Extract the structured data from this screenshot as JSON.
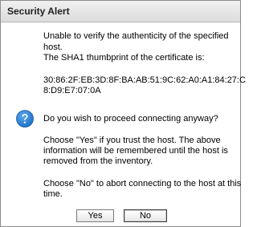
{
  "dialog": {
    "title": "Security Alert",
    "icon": "question-icon",
    "accent_color": "#1a6fc4"
  },
  "message": {
    "line1": "Unable to verify the authenticity of the specified",
    "line2": "host.",
    "line3": "The SHA1 thumbprint of the certificate is:",
    "thumb1": "30:86:2F:EB:3D:8F:BA:AB:51:9C:62:A0:A1:84:27:C",
    "thumb2": "8:D9:E7:07:0A",
    "question": "Do you wish to proceed connecting anyway?",
    "yes1": "Choose \"Yes\" if you trust the host. The above",
    "yes2": "information will be remembered until the host is",
    "yes3": "removed from the inventory.",
    "no1": "Choose \"No\" to abort connecting to the host at this",
    "no2": "time."
  },
  "buttons": {
    "yes": "Yes",
    "no": "No"
  }
}
